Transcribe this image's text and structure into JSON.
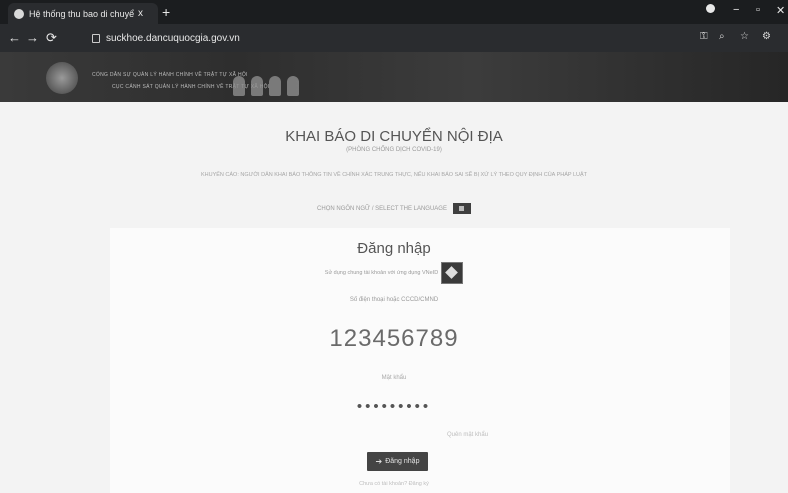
{
  "browser": {
    "tab_title": "Hệ thống thu bao di chuyển nội...",
    "tab_close": "x",
    "new_tab": "+",
    "url": "suckhoe.dancuquocgia.gov.vn",
    "controls": {
      "minimize": "−",
      "maximize": "▫",
      "close": "✕"
    }
  },
  "banner": {
    "line1": "CỔNG DÂN SỰ QUẢN LÝ HÀNH CHÍNH VỀ TRẬT TỰ XÃ HỘI",
    "line2": "CỤC CẢNH SÁT QUẢN LÝ HÀNH CHÍNH VỀ TRẬT TỰ XÃ HỘI"
  },
  "page": {
    "title": "KHAI BÁO DI CHUYỂN NỘI ĐỊA",
    "subtitle": "(PHÒNG CHỐNG DỊCH COVID-19)",
    "description": "KHUYẾN CÁO: NGƯỜI DÂN KHAI BÁO THÔNG TIN VỀ CHÍNH XÁC TRUNG THỰC, NẾU KHAI BÁO SAI SẼ BỊ XỬ LÝ THEO QUY ĐỊNH CỦA PHÁP LUẬT",
    "language_label": "CHỌN NGÔN NGỮ / SELECT THE LANGUAGE"
  },
  "login": {
    "title": "Đăng nhập",
    "qr_text": "Sử dụng chung tài khoản với ứng dụng VNeID",
    "phone_label": "Số điện thoại hoặc CCCD/CMND",
    "phone_value": "123456789",
    "password_label": "Mật khẩu",
    "password_value": "•••••••••",
    "forgot": "Quên mật khẩu",
    "button": "Đăng nhập",
    "register": "Chưa có tài khoản? Đăng ký"
  }
}
